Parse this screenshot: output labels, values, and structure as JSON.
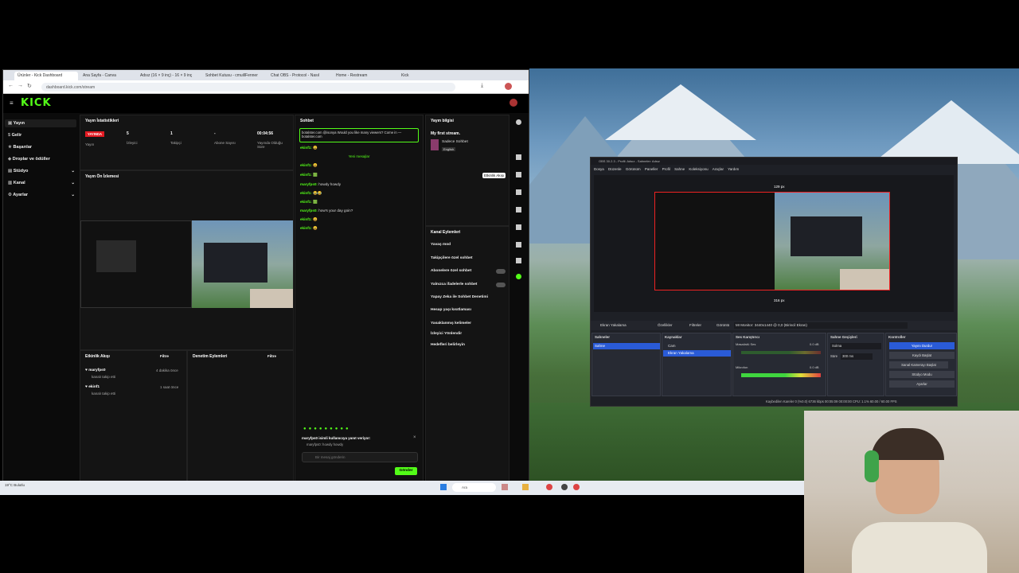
{
  "browser": {
    "tabs": [
      "Ürünler - Kick Dashboard",
      "Ana Sayfa - Canva",
      "Adsız (16 × 9 inç) - 16 × 9 inç",
      "Sohbet Kutusu - cmuillFenner",
      "Chat OBS - Protocol - Nasıl",
      "Home - Restream",
      "Kick"
    ],
    "url": "dashboard.kick.com/stream"
  },
  "kick": {
    "logo": "KICK",
    "sidebar": [
      {
        "label": "Yayın",
        "arrow": ""
      },
      {
        "label": "Gelir",
        "arrow": ""
      },
      {
        "label": "Başarılar",
        "arrow": ""
      },
      {
        "label": "Droplar ve ödüller",
        "arrow": ""
      },
      {
        "label": "Stüdyo",
        "arrow": "⌄"
      },
      {
        "label": "Kanal",
        "arrow": "⌄"
      },
      {
        "label": "Ayarlar",
        "arrow": "⌄"
      }
    ],
    "stats": {
      "title": "Yayın İstatistikleri",
      "live_badge": "YAYINDA",
      "live_label": "Yayın",
      "items": [
        {
          "value": "5",
          "label": "İzleyici"
        },
        {
          "value": "1",
          "label": "Takipçi"
        },
        {
          "value": "-",
          "label": "Abone Sayısı"
        },
        {
          "value": "00:04:56",
          "label": "Yayında Olduğu Süre"
        }
      ]
    },
    "preview_title": "Yayın Ön İzlemesi",
    "activity": {
      "title": "Etkinlik Akışı",
      "filter": "Filtre",
      "items": [
        {
          "name": "maryfps0",
          "action": "kanalı takip etti",
          "time": "4 dakika önce"
        },
        {
          "name": "ekinf1",
          "action": "kanalı takip etti",
          "time": "1 saat önce"
        }
      ]
    },
    "moderation": {
      "title": "Denetim Eylemleri",
      "filter": "Filtre"
    },
    "chat": {
      "title": "Sohbet",
      "pinned": "botalster.com @isonya Would you like many viewers? Come in — botalster.com",
      "new_messages": "Yeni mesajlar",
      "lines": [
        {
          "user": "ekinf1:",
          "text": "😀"
        },
        {
          "user": "ekinf1:",
          "text": "😀"
        },
        {
          "user": "ekinf1:",
          "text": "🟩"
        },
        {
          "user": "maryfps0:",
          "text": "howdy howdy"
        },
        {
          "user": "ekinf1:",
          "text": "😂😂"
        },
        {
          "user": "ekinf1:",
          "text": "🟩"
        },
        {
          "user": "maryfps0:",
          "text": "how's your day goin?"
        },
        {
          "user": "ekinf1:",
          "text": "😀"
        },
        {
          "user": "ekinf1:",
          "text": "😀"
        }
      ],
      "reply_to": "maryfps0 isimli kullanıcıya yanıt veriyor:",
      "reply_text": "maryfps0: howdy howdy",
      "placeholder": "Bir mesaj gönderin",
      "send": "Gönder"
    },
    "stream_info": {
      "title": "Yayın bilgisi",
      "stream_title": "My first stream.",
      "category": "Sadece Sohbet",
      "language": "English"
    },
    "channel_actions": {
      "title": "Kanal Eylemleri",
      "items": [
        "Yavaş mod",
        "Takipçilere özel sohbet",
        "Abonelere özel sohbet",
        "Yalnızca ifadelerle sohbet",
        "Yapay Zeka ile Sohbet Denetimi",
        "Hesap yaşı kısıtlaması",
        "Yasaklanmış kelimeler",
        "İzleyici Yönlendir",
        "Hedefleri belirleyin"
      ]
    },
    "tooltip": "Etkinlik Akışı"
  },
  "obs": {
    "titlebar": "OBS 30.2.3 - Profil: Adsız - Sahneler: Adsız",
    "menu": [
      "Dosya",
      "Düzenle",
      "Görünüm",
      "Paneller",
      "Profil",
      "Sahne Koleksiyonu",
      "Araçlar",
      "Yardım"
    ],
    "dim_top": "129 px",
    "dim_bottom": "316 px",
    "source_bar": {
      "source": "Ekran Yakalama",
      "props": "Özellikler",
      "filters": "Filtreler",
      "display_label": "Görüntü",
      "display_value": "MI Monitor: 3440x1440 @ 0,0 (Birincil Ekran)"
    },
    "scenes": {
      "title": "Sahneler",
      "items": [
        "Sahne"
      ]
    },
    "sources": {
      "title": "Kaynaklar",
      "items": [
        "Cam",
        "Ekran Yakalama"
      ]
    },
    "mixer": {
      "title": "Ses Karıştırıcı",
      "tracks": [
        {
          "name": "Masaüstü Ses",
          "db": "0.0 dB"
        },
        {
          "name": "Mikrofon",
          "db": "0.0 dB"
        }
      ]
    },
    "transitions": {
      "title": "Sahne Geçişleri",
      "type": "Solma",
      "duration_label": "Süre",
      "duration": "300 ms"
    },
    "controls": {
      "title": "Kontroller",
      "buttons": [
        "Yayını Durdur",
        "Kaydı Başlat",
        "Sanal Kamerayı Başlat",
        "Stüdyo Modu",
        "Ayarlar"
      ]
    },
    "status": "Kaybedilen Kareler 0 (%0.0)   6736 kbps   00:05:09   00:00:00   CPU: 1.1%   60.00 / 60.00 FPS"
  },
  "taskbar": {
    "weather": "19°C Bulutlu",
    "search": "Ara"
  },
  "colors": {
    "kick_green": "#53fc18",
    "live_red": "#e31b23",
    "obs_bg": "#1e2026",
    "obs_highlight": "#2a5bd7"
  }
}
